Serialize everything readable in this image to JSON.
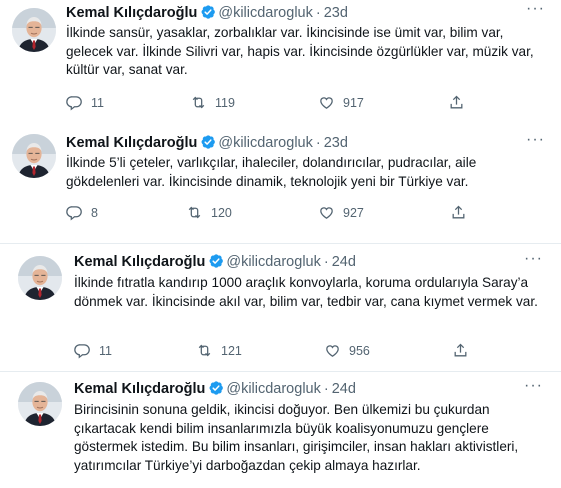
{
  "tweets": [
    {
      "name": "Kemal Kılıçdaroğlu",
      "handle": "@kilicdarogluk",
      "dot": "·",
      "time": "23d",
      "text": "İlkinde sansür, yasaklar, zorbalıklar var. İkincisinde ise ümit var, bilim var, gelecek var. İlkinde Silivri var, hapis var.  İkincisinde özgürlükler var, müzik var, kültür var, sanat var.",
      "replies": "11",
      "retweets": "119",
      "likes": "917"
    },
    {
      "name": "Kemal Kılıçdaroğlu",
      "handle": "@kilicdarogluk",
      "dot": "·",
      "time": "23d",
      "text": "İlkinde 5’li çeteler, varlıkçılar, ihaleciler, dolandırıcılar, pudracılar, aile gökdelenleri var. İkincisinde dinamik, teknolojik yeni bir Türkiye var.",
      "replies": "8",
      "retweets": "120",
      "likes": "927"
    },
    {
      "name": "Kemal Kılıçdaroğlu",
      "handle": "@kilicdarogluk",
      "dot": "·",
      "time": "24d",
      "text": "İlkinde fıtratla kandırıp 1000 araçlık konvoylarla, koruma ordularıyla Saray’a dönmek var. İkincisinde akıl var, bilim var, tedbir var, cana kıymet vermek var.",
      "replies": "11",
      "retweets": "121",
      "likes": "956"
    },
    {
      "name": "Kemal Kılıçdaroğlu",
      "handle": "@kilicdarogluk",
      "dot": "·",
      "time": "24d",
      "text": "Birincisinin sonuna geldik, ikincisi doğuyor. Ben ülkemizi bu çukurdan çıkartacak kendi bilim insanlarımızla büyük koalisyonumuzu gençlere göstermek istedim. Bu bilim insanları, girişimciler, insan hakları aktivistleri, yatırımcılar Türkiye’yi darboğazdan çekip almaya hazırlar."
    }
  ],
  "icons": {
    "reply": "reply-icon",
    "retweet": "retweet-icon",
    "like": "heart-icon",
    "share": "share-icon",
    "verified": "verified-badge-icon",
    "more": "more-options-icon"
  },
  "colors": {
    "verified": "#1d9bf0",
    "secondary": "#536471",
    "text": "#0f1419",
    "divider": "#e6ecf0"
  }
}
